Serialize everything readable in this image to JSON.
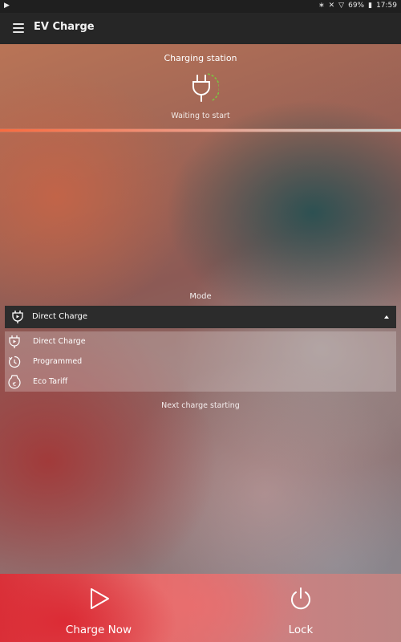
{
  "status_bar": {
    "time": "17:59",
    "battery": "69%",
    "icons": [
      "notification-flag-icon",
      "bluetooth-icon",
      "mute-icon",
      "wifi-icon",
      "battery-icon"
    ]
  },
  "app_bar": {
    "title": "EV Charge",
    "menu_icon": "hamburger-menu-icon"
  },
  "station": {
    "title": "Charging station",
    "status": "Waiting to start",
    "icon": "plug-icon"
  },
  "mode": {
    "label": "Mode",
    "selected": "Direct Charge",
    "options": [
      {
        "label": "Direct Charge",
        "icon": "plug-icon"
      },
      {
        "label": "Programmed",
        "icon": "timer-icon"
      },
      {
        "label": "Eco Tariff",
        "icon": "euro-tag-icon"
      }
    ]
  },
  "next_charge": "Next charge starting",
  "actions": {
    "charge_now": "Charge Now",
    "lock": "Lock"
  },
  "colors": {
    "appbar": "#262626",
    "progress_start": "#ff6a3c",
    "progress_end": "#cfeaea",
    "accent_green": "#7cc242",
    "bottom_bar": "#d9323a"
  }
}
